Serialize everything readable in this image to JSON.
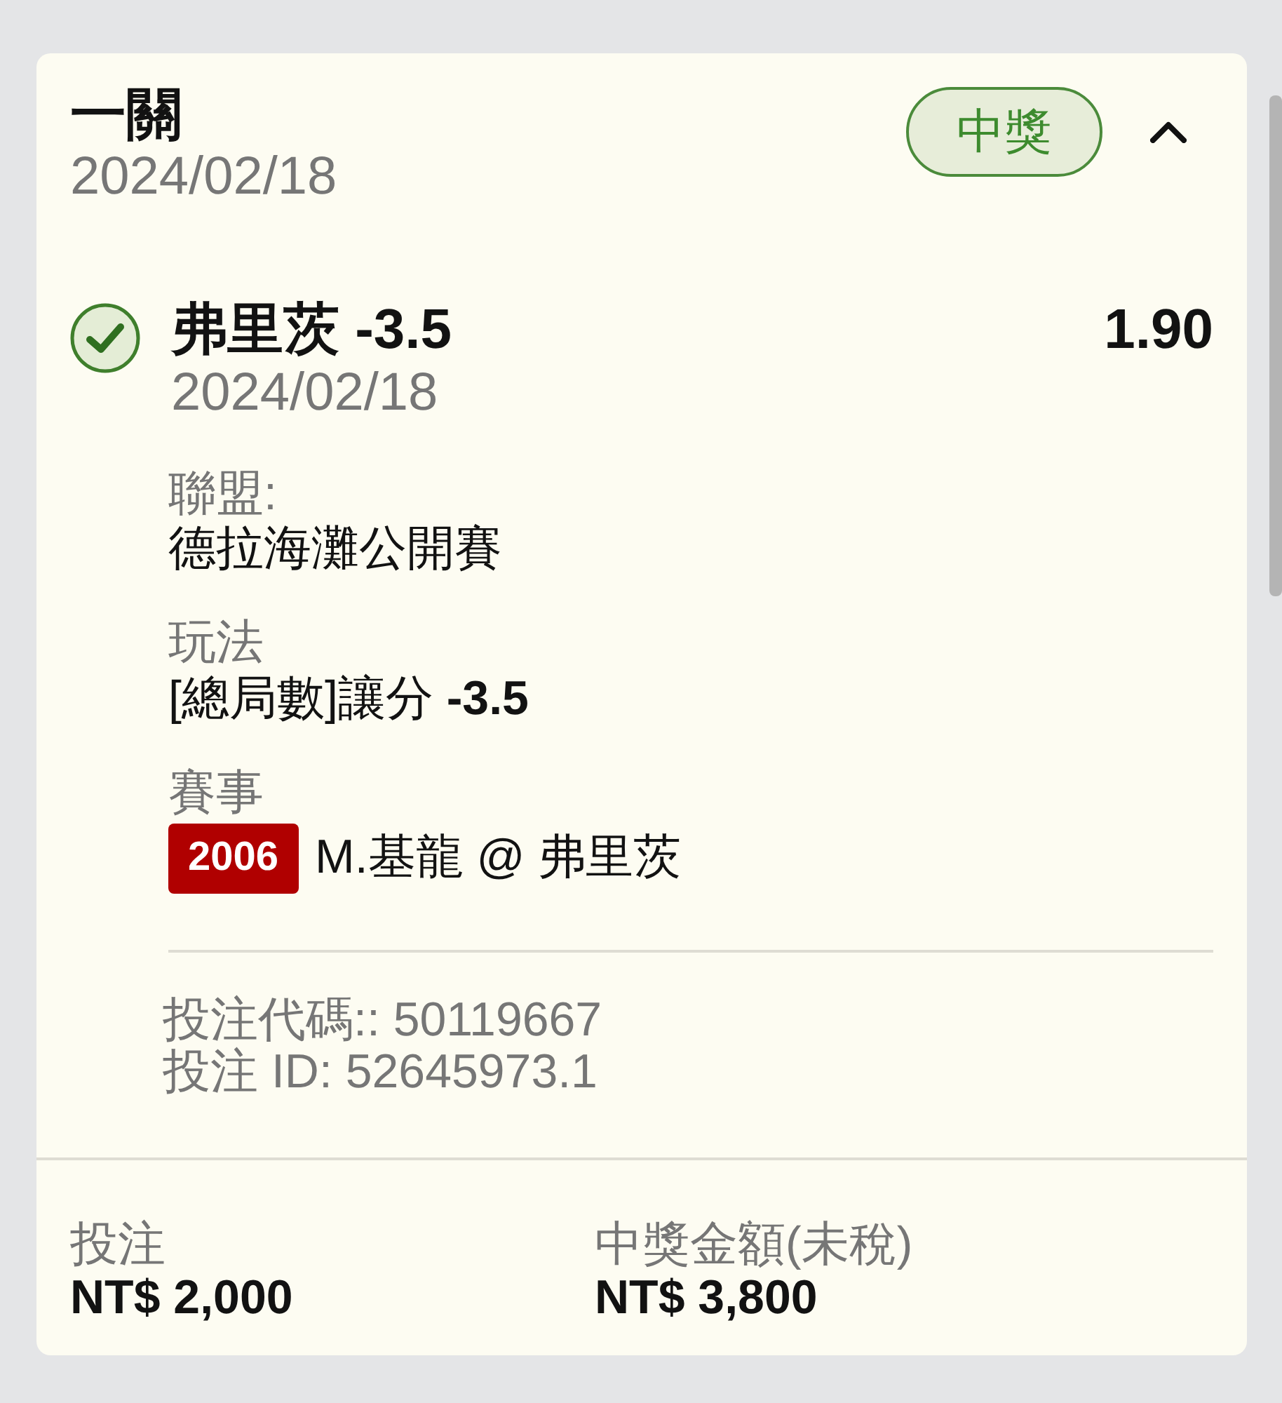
{
  "bet": {
    "title": "一關",
    "date": "2024/02/18",
    "status": {
      "label": "中獎",
      "won": true
    },
    "expanded": true
  },
  "selection": {
    "won": true,
    "name": "弗里茨 -3.5",
    "date": "2024/02/18",
    "odds": "1.90"
  },
  "details": [
    {
      "label": "聯盟:",
      "value": "德拉海灘公開賽"
    },
    {
      "label": "玩法",
      "value": "[總局數]讓分 **-3.5**"
    },
    {
      "label": "賽事",
      "event_code": "2006",
      "value": "M.基龍 @ 弗里茨"
    }
  ],
  "references": [
    "投注代碼:: 50119667",
    "投注 ID: 52645973.1"
  ],
  "totals": [
    {
      "label": "投注",
      "amount": "NT$ 2,000"
    },
    {
      "label": "中獎金額(未稅)",
      "amount": "NT$ 3,800"
    }
  ]
}
